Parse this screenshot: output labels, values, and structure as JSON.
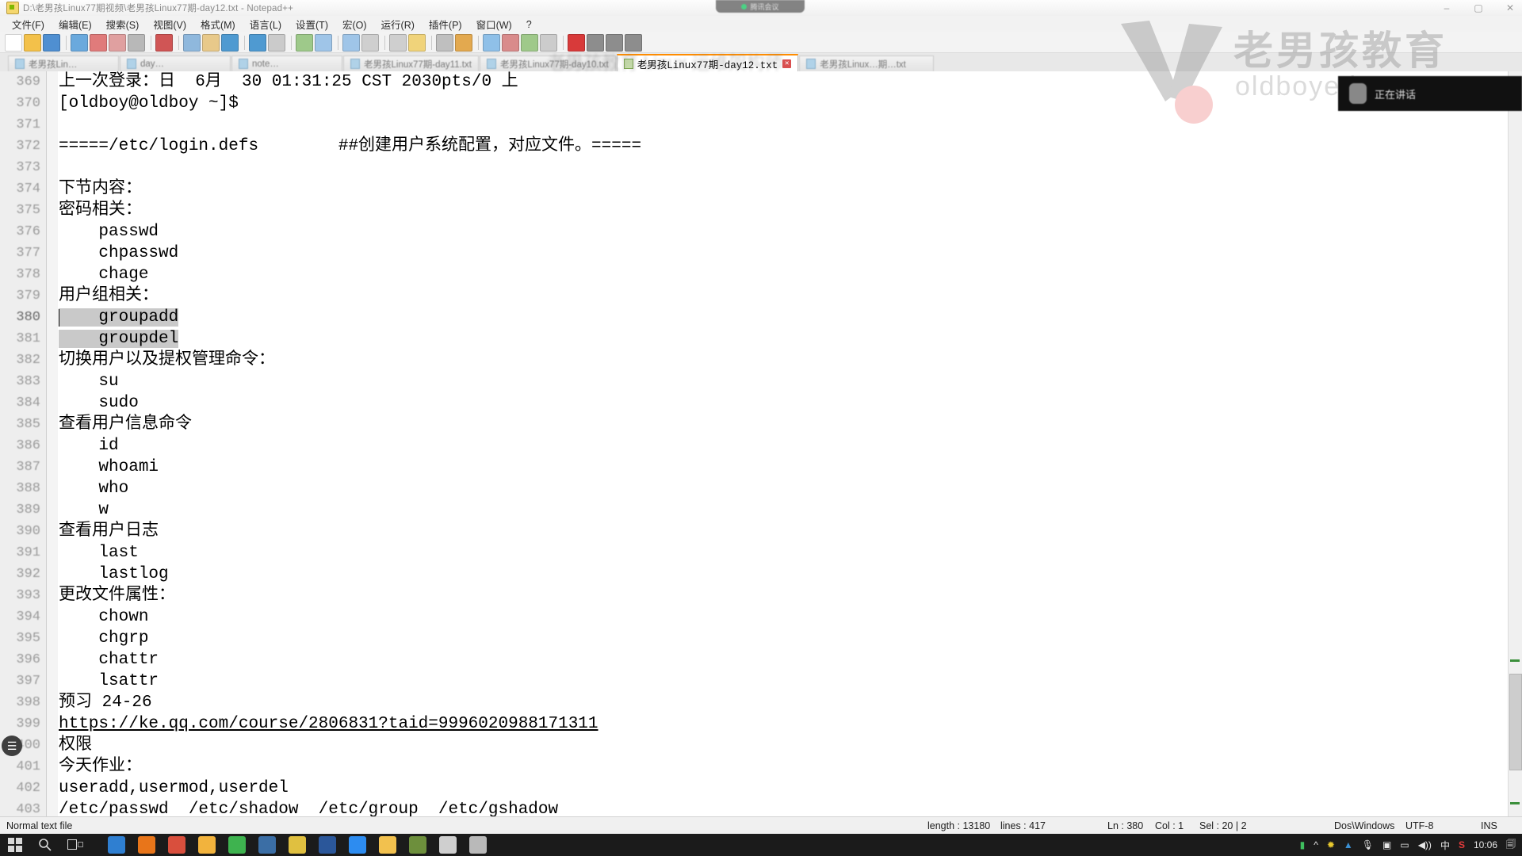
{
  "window": {
    "title": "D:\\老男孩Linux77期视频\\老男孩Linux77期-day12.txt - Notepad++",
    "app_icon": "notepadpp-icon",
    "minimize": "–",
    "maximize": "▢",
    "close": "✕"
  },
  "menu": [
    {
      "label": "文件(F)"
    },
    {
      "label": "编辑(E)"
    },
    {
      "label": "搜索(S)"
    },
    {
      "label": "视图(V)"
    },
    {
      "label": "格式(M)"
    },
    {
      "label": "语言(L)"
    },
    {
      "label": "设置(T)"
    },
    {
      "label": "宏(O)"
    },
    {
      "label": "运行(R)"
    },
    {
      "label": "插件(P)"
    },
    {
      "label": "窗口(W)"
    },
    {
      "label": "?"
    }
  ],
  "toolbar": {
    "buttons": [
      {
        "name": "new-file-icon",
        "color": "#ffffff"
      },
      {
        "name": "open-file-icon",
        "color": "#f3c14a"
      },
      {
        "name": "save-icon",
        "color": "#4f8fd1"
      },
      {
        "name": "save-all-icon",
        "color": "#6aa9dd"
      },
      {
        "name": "close-file-icon",
        "color": "#e07b7b"
      },
      {
        "name": "close-all-icon",
        "color": "#e0a0a0"
      },
      {
        "name": "print-icon",
        "color": "#b8b8b8"
      },
      {
        "name": "cut-icon",
        "color": "#d05555"
      },
      {
        "name": "copy-icon",
        "color": "#8fb8dd"
      },
      {
        "name": "paste-icon",
        "color": "#e8c98a"
      },
      {
        "name": "undo-icon",
        "color": "#4f9ad1"
      },
      {
        "name": "redo-icon",
        "color": "#4f9ad1"
      },
      {
        "name": "find-icon",
        "color": "#cbcbcb"
      },
      {
        "name": "replace-icon",
        "color": "#9ec98a"
      },
      {
        "name": "zoom-in-icon",
        "color": "#9fc5e8"
      },
      {
        "name": "zoom-out-icon",
        "color": "#9fc5e8"
      },
      {
        "name": "sync-v-icon",
        "color": "#cfcfcf"
      },
      {
        "name": "sync-h-icon",
        "color": "#cfcfcf"
      },
      {
        "name": "word-wrap-icon",
        "color": "#f0d37a"
      },
      {
        "name": "all-chars-icon",
        "color": "#bfbfbf"
      },
      {
        "name": "indent-guide-icon",
        "color": "#e3a94f"
      },
      {
        "name": "ui-userdefined-icon",
        "color": "#8fc0e8"
      },
      {
        "name": "doc-map-icon",
        "color": "#d98b8b"
      },
      {
        "name": "function-list-icon",
        "color": "#9fc98a"
      },
      {
        "name": "folder-workspace-icon",
        "color": "#cccccc"
      },
      {
        "name": "macro-record-icon",
        "color": "#d83a3a"
      },
      {
        "name": "macro-stop-icon",
        "color": "#8d8d8d"
      },
      {
        "name": "macro-play-icon",
        "color": "#8d8d8d"
      },
      {
        "name": "macro-save-icon",
        "color": "#8d8d8d"
      }
    ]
  },
  "tabs": {
    "inactive_left": [
      {
        "label": "老男孩Lin…",
        "icon": "file-icon"
      },
      {
        "label": "day…",
        "icon": "file-icon"
      },
      {
        "label": "note…",
        "icon": "file-icon"
      },
      {
        "label": "老男孩Linux77期-day11.txt",
        "icon": "file-icon"
      },
      {
        "label": "老男孩Linux77期-day10.txt",
        "icon": "file-icon"
      }
    ],
    "active": {
      "label": "老男孩Linux77期-day12.txt",
      "icon": "file-icon",
      "close": "✕"
    },
    "inactive_right": [
      {
        "label": "老男孩Linux…期…txt",
        "icon": "file-icon"
      }
    ]
  },
  "editor": {
    "first_line_number": 369,
    "caret": {
      "line": 380,
      "col": 1
    },
    "bookmark_line": 400,
    "selected_lines": [
      380,
      381
    ],
    "lines": [
      {
        "n": 369,
        "text": "上一次登录：日  6月  30 01:31:25 CST 2030pts/0 上"
      },
      {
        "n": 370,
        "text": "[oldboy@oldboy ~]$"
      },
      {
        "n": 371,
        "text": ""
      },
      {
        "n": 372,
        "text": "=====/etc/login.defs        ##创建用户系统配置，对应文件。====="
      },
      {
        "n": 373,
        "text": ""
      },
      {
        "n": 374,
        "text": "下节内容："
      },
      {
        "n": 375,
        "text": "密码相关："
      },
      {
        "n": 376,
        "text": "    passwd"
      },
      {
        "n": 377,
        "text": "    chpasswd"
      },
      {
        "n": 378,
        "text": "    chage"
      },
      {
        "n": 379,
        "text": "用户组相关："
      },
      {
        "n": 380,
        "text": "    groupadd"
      },
      {
        "n": 381,
        "text": "    groupdel"
      },
      {
        "n": 382,
        "text": "切换用户以及提权管理命令："
      },
      {
        "n": 383,
        "text": "    su"
      },
      {
        "n": 384,
        "text": "    sudo"
      },
      {
        "n": 385,
        "text": "查看用户信息命令"
      },
      {
        "n": 386,
        "text": "    id"
      },
      {
        "n": 387,
        "text": "    whoami"
      },
      {
        "n": 388,
        "text": "    who"
      },
      {
        "n": 389,
        "text": "    w"
      },
      {
        "n": 390,
        "text": "查看用户日志"
      },
      {
        "n": 391,
        "text": "    last"
      },
      {
        "n": 392,
        "text": "    lastlog"
      },
      {
        "n": 393,
        "text": "更改文件属性："
      },
      {
        "n": 394,
        "text": "    chown"
      },
      {
        "n": 395,
        "text": "    chgrp"
      },
      {
        "n": 396,
        "text": "    chattr"
      },
      {
        "n": 397,
        "text": "    lsattr"
      },
      {
        "n": 398,
        "text": "预习 24-26"
      },
      {
        "n": 399,
        "text": "https://ke.qq.com/course/2806831?taid=9996020988171311",
        "link": true
      },
      {
        "n": 400,
        "text": "权限"
      },
      {
        "n": 401,
        "text": "今天作业："
      },
      {
        "n": 402,
        "text": "useradd,usermod,userdel"
      },
      {
        "n": 403,
        "text": "/etc/passwd  /etc/shadow  /etc/group  /etc/gshadow"
      }
    ]
  },
  "statusbar": {
    "doc_type": "Normal text file",
    "length_label": "length : 13180",
    "lines_label": "lines : 417",
    "ln": "Ln : 380",
    "col": "Col : 1",
    "sel": "Sel : 20 | 2",
    "eol": "Dos\\Windows",
    "encoding": "UTF-8",
    "insert_mode": "INS"
  },
  "taskbar": {
    "start": "start-icon",
    "search": "search-icon",
    "taskview": "task-view-icon",
    "apps": [
      {
        "name": "edge-icon",
        "color": "#2f7fd1"
      },
      {
        "name": "firefox-icon",
        "color": "#e8751a"
      },
      {
        "name": "chrome-icon",
        "color": "#d94f3d"
      },
      {
        "name": "file-explorer-icon",
        "color": "#f2b33d"
      },
      {
        "name": "wechat-icon",
        "color": "#3eb34f"
      },
      {
        "name": "xshell-icon",
        "color": "#3b6ea5"
      },
      {
        "name": "notepadpp-icon",
        "color": "#e0c040"
      },
      {
        "name": "word-icon",
        "color": "#2b579a"
      },
      {
        "name": "tencent-meeting-icon",
        "color": "#2d8cf0"
      },
      {
        "name": "folder-icon",
        "color": "#f2c14e"
      },
      {
        "name": "vmware-icon",
        "color": "#6d8f3c"
      },
      {
        "name": "notepad-icon",
        "color": "#cfcfcf"
      },
      {
        "name": "text-doc-icon",
        "color": "#b9b9b9"
      }
    ],
    "tray": {
      "show-hidden-icon": "^",
      "battery-icon": "battery",
      "sogou-icon": "S",
      "ime-label": "中",
      "volume-icon": "volume",
      "network-icon": "network",
      "mic-icon": "mic",
      "clock": "10:06",
      "notification-icon": "notify"
    }
  },
  "overlays": {
    "meeting_toolbar_label": "腾讯会议",
    "speaking_label": "正在讲话",
    "watermark_cn": "老男孩教育",
    "watermark_en": "oldboyedu.com"
  }
}
